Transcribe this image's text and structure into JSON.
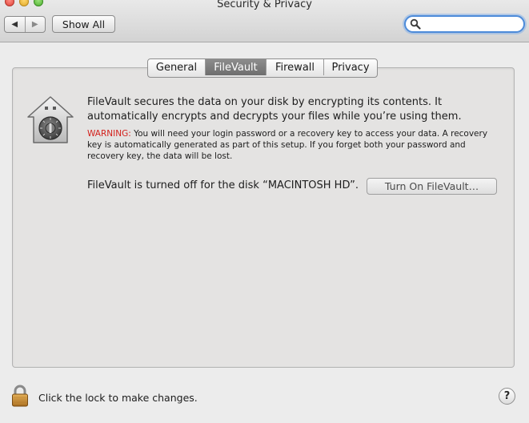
{
  "window": {
    "title": "Security & Privacy"
  },
  "toolbar": {
    "back_glyph": "◀",
    "forward_glyph": "▶",
    "show_all_label": "Show All",
    "search": {
      "value": "",
      "placeholder": "",
      "icon": "search-icon"
    }
  },
  "tabs": [
    {
      "label": "General",
      "selected": false
    },
    {
      "label": "FileVault",
      "selected": true
    },
    {
      "label": "Firewall",
      "selected": false
    },
    {
      "label": "Privacy",
      "selected": false
    }
  ],
  "filevault": {
    "icon": "filevault-house-icon",
    "description": "FileVault secures the data on your disk by encrypting its contents. It automatically encrypts and decrypts your files while you’re using them.",
    "warning_label": "WARNING:",
    "warning_text": " You will need your login password or a recovery key to access your data. A recovery key is automatically generated as part of this setup. If you forget both your password and recovery key, the data will be lost.",
    "status": "FileVault is turned off for the disk “MACINTOSH HD”.",
    "turn_on_label": "Turn On FileVault…"
  },
  "footer": {
    "lock_icon": "lock-icon",
    "lock_text": "Click the lock to make changes.",
    "help_label": "?"
  },
  "colors": {
    "warning": "#d3211c",
    "search_focus": "#4d8bd9",
    "selected_tab": "#7a7a7a"
  }
}
